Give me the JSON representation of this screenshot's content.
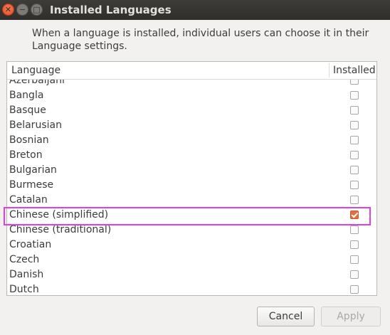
{
  "window": {
    "title": "Installed Languages",
    "close_glyph": "✕",
    "min_glyph": "−",
    "max_glyph": "□"
  },
  "description": "When a language is installed, individual users can choose it in their Language settings.",
  "table": {
    "col_language": "Language",
    "col_installed": "Installed",
    "rows": [
      {
        "name": "Azerbaijani",
        "installed": false
      },
      {
        "name": "Bangla",
        "installed": false
      },
      {
        "name": "Basque",
        "installed": false
      },
      {
        "name": "Belarusian",
        "installed": false
      },
      {
        "name": "Bosnian",
        "installed": false
      },
      {
        "name": "Breton",
        "installed": false
      },
      {
        "name": "Bulgarian",
        "installed": false
      },
      {
        "name": "Burmese",
        "installed": false
      },
      {
        "name": "Catalan",
        "installed": false
      },
      {
        "name": "Chinese (simplified)",
        "installed": true
      },
      {
        "name": "Chinese (traditional)",
        "installed": false
      },
      {
        "name": "Croatian",
        "installed": false
      },
      {
        "name": "Czech",
        "installed": false
      },
      {
        "name": "Danish",
        "installed": false
      },
      {
        "name": "Dutch",
        "installed": false
      }
    ]
  },
  "buttons": {
    "cancel": "Cancel",
    "apply": "Apply"
  },
  "colors": {
    "highlight": "#e040e0",
    "checkbox_checked": "#e86d3a"
  }
}
